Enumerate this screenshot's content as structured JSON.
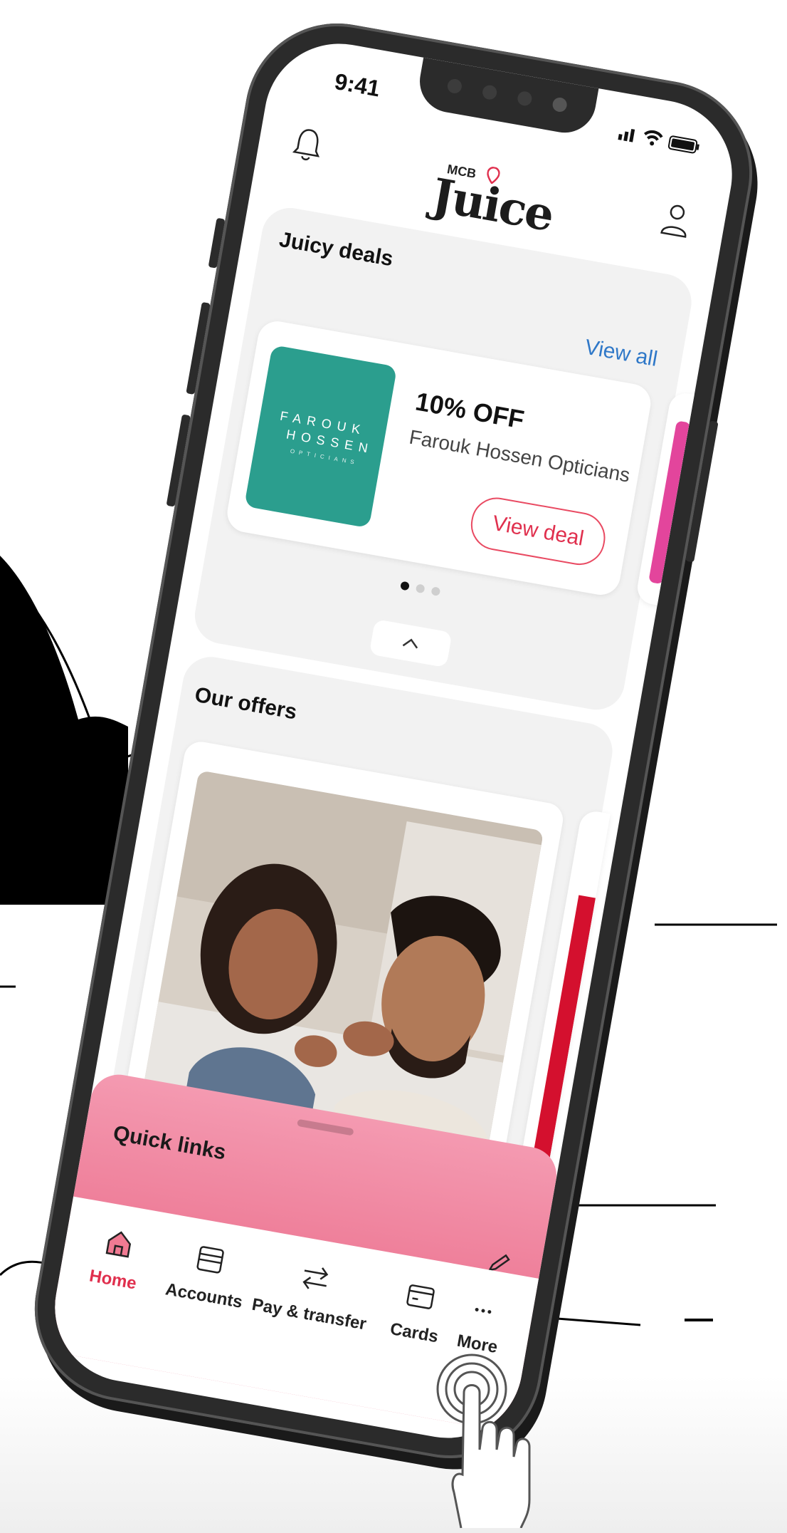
{
  "status": {
    "time": "9:41"
  },
  "header": {
    "logo_small": "MCB",
    "logo_main": "Juice"
  },
  "deals": {
    "title": "Juicy deals",
    "view_all": "View all",
    "card": {
      "logo_line1": "FAROUK",
      "logo_line2": "HOSSEN",
      "logo_line3": "OPTICIANS",
      "offer": "10% OFF",
      "merchant": "Farouk Hossen Opticians",
      "button": "View deal"
    },
    "pager": {
      "count": 3,
      "active": 1
    }
  },
  "offers": {
    "title": "Our offers"
  },
  "quick_links": {
    "title": "Quick links"
  },
  "tabs": [
    {
      "label": "Home",
      "icon": "home-icon",
      "active": true
    },
    {
      "label": "Accounts",
      "icon": "accounts-icon"
    },
    {
      "label": "Pay & transfer",
      "icon": "transfer-icon"
    },
    {
      "label": "Cards",
      "icon": "card-icon"
    },
    {
      "label": "More",
      "icon": "more-icon"
    }
  ],
  "colors": {
    "accent": "#e0304e",
    "link": "#2f78c8",
    "deal_logo_bg": "#2b9e8e",
    "quick_links_bg": "#f49ab1"
  }
}
